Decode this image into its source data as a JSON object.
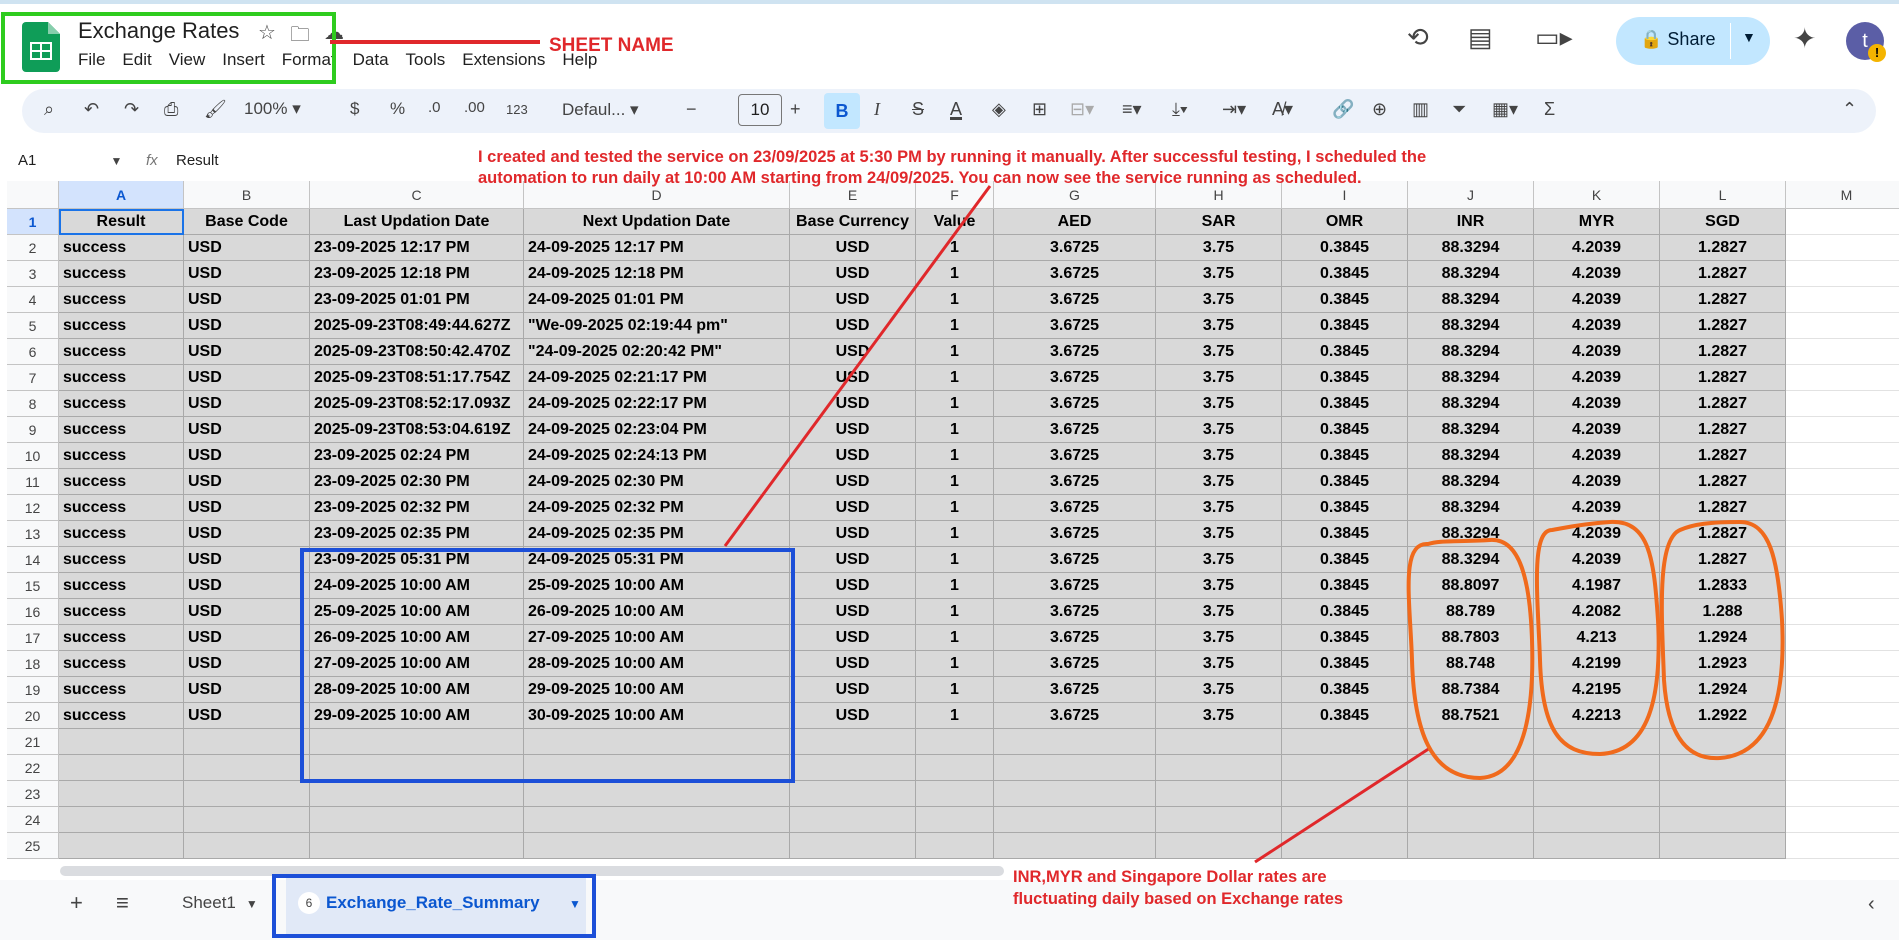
{
  "app": {
    "title": "Exchange Rates",
    "menu": [
      "File",
      "Edit",
      "View",
      "Insert",
      "Format",
      "Data",
      "Tools",
      "Extensions",
      "Help"
    ],
    "share_label": "Share",
    "avatar_letter": "t"
  },
  "toolbar": {
    "zoom": "100%",
    "currency": "$",
    "percent": "%",
    "dec_decrease": ".0",
    "dec_increase": ".00",
    "number_format": "123",
    "font": "Defaul...",
    "font_size": "10",
    "bold": "B",
    "italic": "I",
    "strike": "S",
    "text_color": "A",
    "minus": "−",
    "plus": "+"
  },
  "formula": {
    "cell_ref": "A1",
    "fx": "fx",
    "value": "Result"
  },
  "grid": {
    "columns": [
      "A",
      "B",
      "C",
      "D",
      "E",
      "F",
      "G",
      "H",
      "I",
      "J",
      "K",
      "L",
      "M"
    ],
    "rows": [
      "1",
      "2",
      "3",
      "4",
      "5",
      "6",
      "7",
      "8",
      "9",
      "10",
      "11",
      "12",
      "13",
      "14",
      "15",
      "16",
      "17",
      "18",
      "19",
      "20",
      "21",
      "22",
      "23",
      "24",
      "25"
    ],
    "headers": [
      "Result",
      "Base Code",
      "Last Updation Date",
      "Next Updation Date",
      "Base Currency",
      "Value",
      "AED",
      "SAR",
      "OMR",
      "INR",
      "MYR",
      "SGD"
    ],
    "data": [
      [
        "success",
        "USD",
        "23-09-2025 12:17 PM",
        "24-09-2025 12:17 PM",
        "USD",
        "1",
        "3.6725",
        "3.75",
        "0.3845",
        "88.3294",
        "4.2039",
        "1.2827"
      ],
      [
        "success",
        "USD",
        "23-09-2025 12:18 PM",
        "24-09-2025 12:18 PM",
        "USD",
        "1",
        "3.6725",
        "3.75",
        "0.3845",
        "88.3294",
        "4.2039",
        "1.2827"
      ],
      [
        "success",
        "USD",
        "23-09-2025 01:01 PM",
        "24-09-2025 01:01 PM",
        "USD",
        "1",
        "3.6725",
        "3.75",
        "0.3845",
        "88.3294",
        "4.2039",
        "1.2827"
      ],
      [
        "success",
        "USD",
        "2025-09-23T08:49:44.627Z",
        "\"We-09-2025 02:19:44 pm\"",
        "USD",
        "1",
        "3.6725",
        "3.75",
        "0.3845",
        "88.3294",
        "4.2039",
        "1.2827"
      ],
      [
        "success",
        "USD",
        "2025-09-23T08:50:42.470Z",
        "\"24-09-2025 02:20:42 PM\"",
        "USD",
        "1",
        "3.6725",
        "3.75",
        "0.3845",
        "88.3294",
        "4.2039",
        "1.2827"
      ],
      [
        "success",
        "USD",
        "2025-09-23T08:51:17.754Z",
        "24-09-2025 02:21:17 PM",
        "USD",
        "1",
        "3.6725",
        "3.75",
        "0.3845",
        "88.3294",
        "4.2039",
        "1.2827"
      ],
      [
        "success",
        "USD",
        "2025-09-23T08:52:17.093Z",
        "24-09-2025 02:22:17 PM",
        "USD",
        "1",
        "3.6725",
        "3.75",
        "0.3845",
        "88.3294",
        "4.2039",
        "1.2827"
      ],
      [
        "success",
        "USD",
        "2025-09-23T08:53:04.619Z",
        "24-09-2025 02:23:04 PM",
        "USD",
        "1",
        "3.6725",
        "3.75",
        "0.3845",
        "88.3294",
        "4.2039",
        "1.2827"
      ],
      [
        "success",
        "USD",
        "23-09-2025 02:24 PM",
        "24-09-2025 02:24:13 PM",
        "USD",
        "1",
        "3.6725",
        "3.75",
        "0.3845",
        "88.3294",
        "4.2039",
        "1.2827"
      ],
      [
        "success",
        "USD",
        "23-09-2025 02:30 PM",
        "24-09-2025 02:30 PM",
        "USD",
        "1",
        "3.6725",
        "3.75",
        "0.3845",
        "88.3294",
        "4.2039",
        "1.2827"
      ],
      [
        "success",
        "USD",
        "23-09-2025 02:32 PM",
        "24-09-2025 02:32 PM",
        "USD",
        "1",
        "3.6725",
        "3.75",
        "0.3845",
        "88.3294",
        "4.2039",
        "1.2827"
      ],
      [
        "success",
        "USD",
        "23-09-2025 02:35 PM",
        "24-09-2025 02:35 PM",
        "USD",
        "1",
        "3.6725",
        "3.75",
        "0.3845",
        "88.3294",
        "4.2039",
        "1.2827"
      ],
      [
        "success",
        "USD",
        "23-09-2025 05:31 PM",
        "24-09-2025 05:31 PM",
        "USD",
        "1",
        "3.6725",
        "3.75",
        "0.3845",
        "88.3294",
        "4.2039",
        "1.2827"
      ],
      [
        "success",
        "USD",
        "24-09-2025 10:00 AM",
        "25-09-2025 10:00 AM",
        "USD",
        "1",
        "3.6725",
        "3.75",
        "0.3845",
        "88.8097",
        "4.1987",
        "1.2833"
      ],
      [
        "success",
        "USD",
        "25-09-2025 10:00 AM",
        "26-09-2025 10:00 AM",
        "USD",
        "1",
        "3.6725",
        "3.75",
        "0.3845",
        "88.789",
        "4.2082",
        "1.288"
      ],
      [
        "success",
        "USD",
        "26-09-2025 10:00 AM",
        "27-09-2025 10:00 AM",
        "USD",
        "1",
        "3.6725",
        "3.75",
        "0.3845",
        "88.7803",
        "4.213",
        "1.2924"
      ],
      [
        "success",
        "USD",
        "27-09-2025 10:00 AM",
        "28-09-2025 10:00 AM",
        "USD",
        "1",
        "3.6725",
        "3.75",
        "0.3845",
        "88.748",
        "4.2199",
        "1.2923"
      ],
      [
        "success",
        "USD",
        "28-09-2025 10:00 AM",
        "29-09-2025 10:00 AM",
        "USD",
        "1",
        "3.6725",
        "3.75",
        "0.3845",
        "88.7384",
        "4.2195",
        "1.2924"
      ],
      [
        "success",
        "USD",
        "29-09-2025 10:00 AM",
        "30-09-2025 10:00 AM",
        "USD",
        "1",
        "3.6725",
        "3.75",
        "0.3845",
        "88.7521",
        "4.2213",
        "1.2922"
      ]
    ]
  },
  "sheets": {
    "tabs": [
      "Sheet1",
      "Exchange_Rate_Summary"
    ],
    "active_badge": "6"
  },
  "annotations": {
    "sheet_name": "SHEET NAME",
    "testing_note_line1": "I created and tested the service on 23/09/2025 at 5:30 PM by running it manually. After successful testing, I scheduled the",
    "testing_note_line2": "automation to run daily at 10:00 AM starting from 24/09/2025. You can now see the service running as scheduled.",
    "fluct_line1": "INR,MYR and Singapore Dollar rates are",
    "fluct_line2": "fluctuating daily based on Exchange rates",
    "colors": {
      "green": "#2ecc1e",
      "blue": "#1c4fd8",
      "red": "#e0282b",
      "orange": "#f06a1c"
    }
  }
}
